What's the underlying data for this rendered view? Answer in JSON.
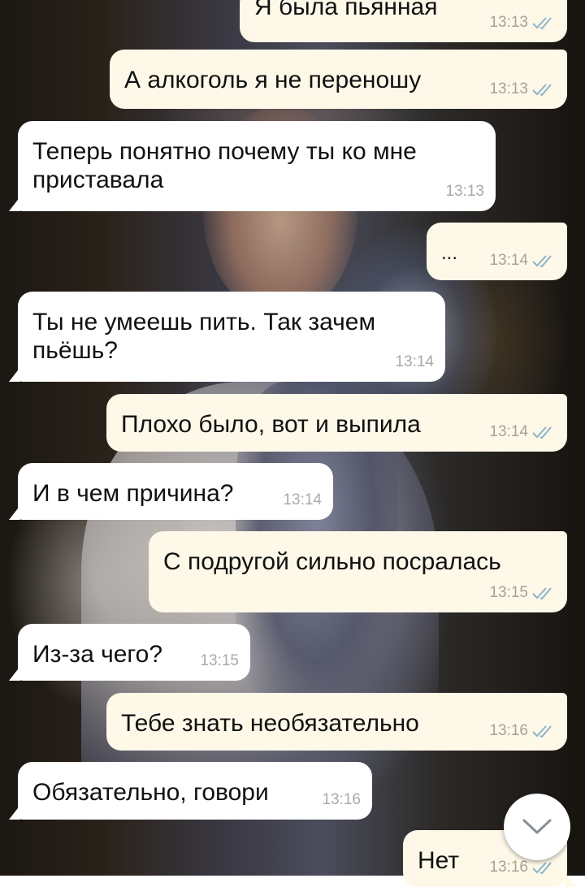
{
  "messages": [
    {
      "dir": "out",
      "text": "Я была пьянная",
      "time": "13:13",
      "read": true
    },
    {
      "dir": "out",
      "text": "А алкоголь я не переношу",
      "time": "13:13",
      "read": true
    },
    {
      "dir": "in",
      "text": "Теперь понятно почему ты ко мне приставала",
      "time": "13:13"
    },
    {
      "dir": "out",
      "text": "...",
      "time": "13:14",
      "read": true
    },
    {
      "dir": "in",
      "text": "Ты не умеешь пить. Так зачем пьёшь?",
      "time": "13:14"
    },
    {
      "dir": "out",
      "text": "Плохо было, вот и выпила",
      "time": "13:14",
      "read": true
    },
    {
      "dir": "in",
      "text": "И в чем причина?",
      "time": "13:14"
    },
    {
      "dir": "out",
      "text": "С подругой сильно посралась",
      "time": "13:15",
      "read": true
    },
    {
      "dir": "in",
      "text": "Из-за чего?",
      "time": "13:15"
    },
    {
      "dir": "out",
      "text": "Тебе знать необязательно",
      "time": "13:16",
      "read": true
    },
    {
      "dir": "in",
      "text": "Обязательно, говори",
      "time": "13:16"
    },
    {
      "dir": "out",
      "text": "Нет",
      "time": "13:16",
      "read": true
    }
  ],
  "scroll_button": {
    "icon": "chevron-down-icon"
  },
  "colors": {
    "outgoing_bubble": "#fdf8e8",
    "incoming_bubble": "#ffffff",
    "read_ticks": "#8fb3c8"
  }
}
